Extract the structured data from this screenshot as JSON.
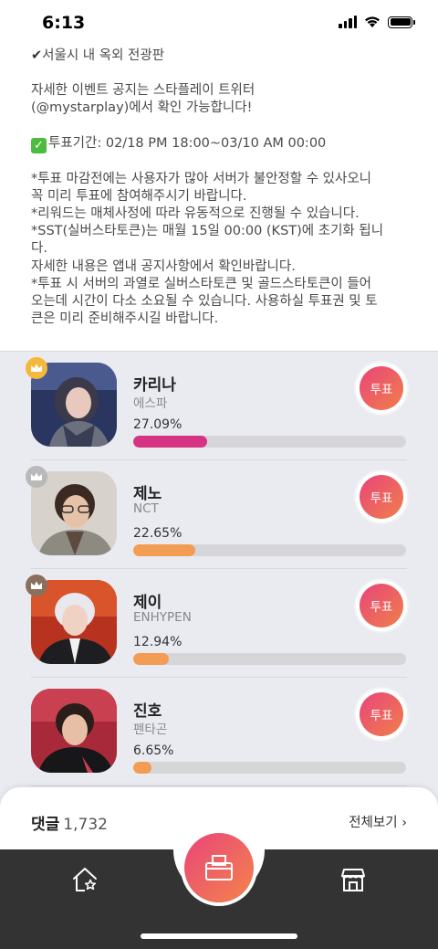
{
  "status": {
    "time": "6:13"
  },
  "notice": {
    "line1": "서울시 내 옥외 전광판",
    "line2": "자세한 이벤트 공지는 스타플레이 트위터\n(@mystarplay)에서 확인 가능합니다!",
    "period": "투표기간: 02/18 PM 18:00~03/10 AM 00:00",
    "details": "*투표 마감전에는 사용자가 많아 서버가 불안정할 수 있사오니\n꼭 미리 투표에 참여해주시기 바랍니다.\n*리워드는 매체사정에 따라 유동적으로 진행될 수 있습니다.\n*SST(실버스타토큰)는 매월 15일 00:00 (KST)에 초기화 됩니\n다.\n자세한 내용은 앱내 공지사항에서 확인바랍니다.\n*투표 시 서버의 과열로 실버스타토큰 및 골드스타토큰이 들어\n오는데 시간이 다소 소요될 수 있습니다. 사용하실 투표권 및 토\n큰은 미리 준비해주시길 바랍니다."
  },
  "vote_label": "투표",
  "candidates": [
    {
      "name": "카리나",
      "group": "에스파",
      "percent_text": "27.09%",
      "percent": 27.09,
      "bar_color": "#d63384",
      "crown_color": "#f5b83a"
    },
    {
      "name": "제노",
      "group": "NCT",
      "percent_text": "22.65%",
      "percent": 22.65,
      "bar_color": "#f39c53",
      "crown_color": "#b9b9b9"
    },
    {
      "name": "제이",
      "group": "ENHYPEN",
      "percent_text": "12.94%",
      "percent": 12.94,
      "bar_color": "#f39c53",
      "crown_color": "#8a6f5e"
    },
    {
      "name": "진호",
      "group": "펜타곤",
      "percent_text": "6.65%",
      "percent": 6.65,
      "bar_color": "#f39c53",
      "crown_color": ""
    }
  ],
  "comments": {
    "label": "댓글",
    "count": "1,732",
    "view_all": "전체보기 ›"
  },
  "nav": {
    "items": [
      "home-star-icon",
      "ballot-box-icon",
      "store-icon"
    ]
  }
}
